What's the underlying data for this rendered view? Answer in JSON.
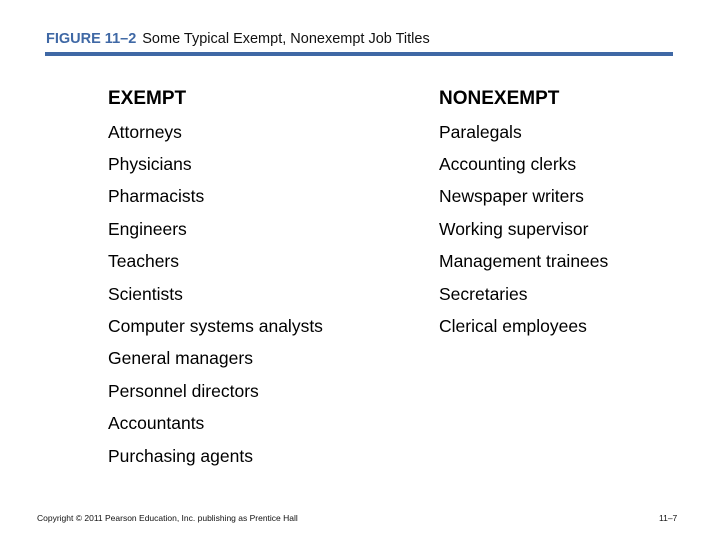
{
  "figure": {
    "label": "FIGURE 11–2",
    "title": "Some Typical Exempt, Nonexempt Job Titles",
    "accent_color": "#3f68a5"
  },
  "columns": {
    "exempt": {
      "header": "EXEMPT",
      "items": [
        "Attorneys",
        "Physicians",
        "Pharmacists",
        "Engineers",
        "Teachers",
        "Scientists",
        "Computer systems analysts",
        "General managers",
        "Personnel directors",
        "Accountants",
        "Purchasing agents"
      ]
    },
    "nonexempt": {
      "header": "NONEXEMPT",
      "items": [
        "Paralegals",
        "Accounting clerks",
        "Newspaper writers",
        "Working supervisor",
        "Management trainees",
        "Secretaries",
        "Clerical employees"
      ]
    }
  },
  "footer": {
    "copyright": "Copyright © 2011 Pearson Education, Inc. publishing as Prentice Hall",
    "page": "11–7"
  }
}
